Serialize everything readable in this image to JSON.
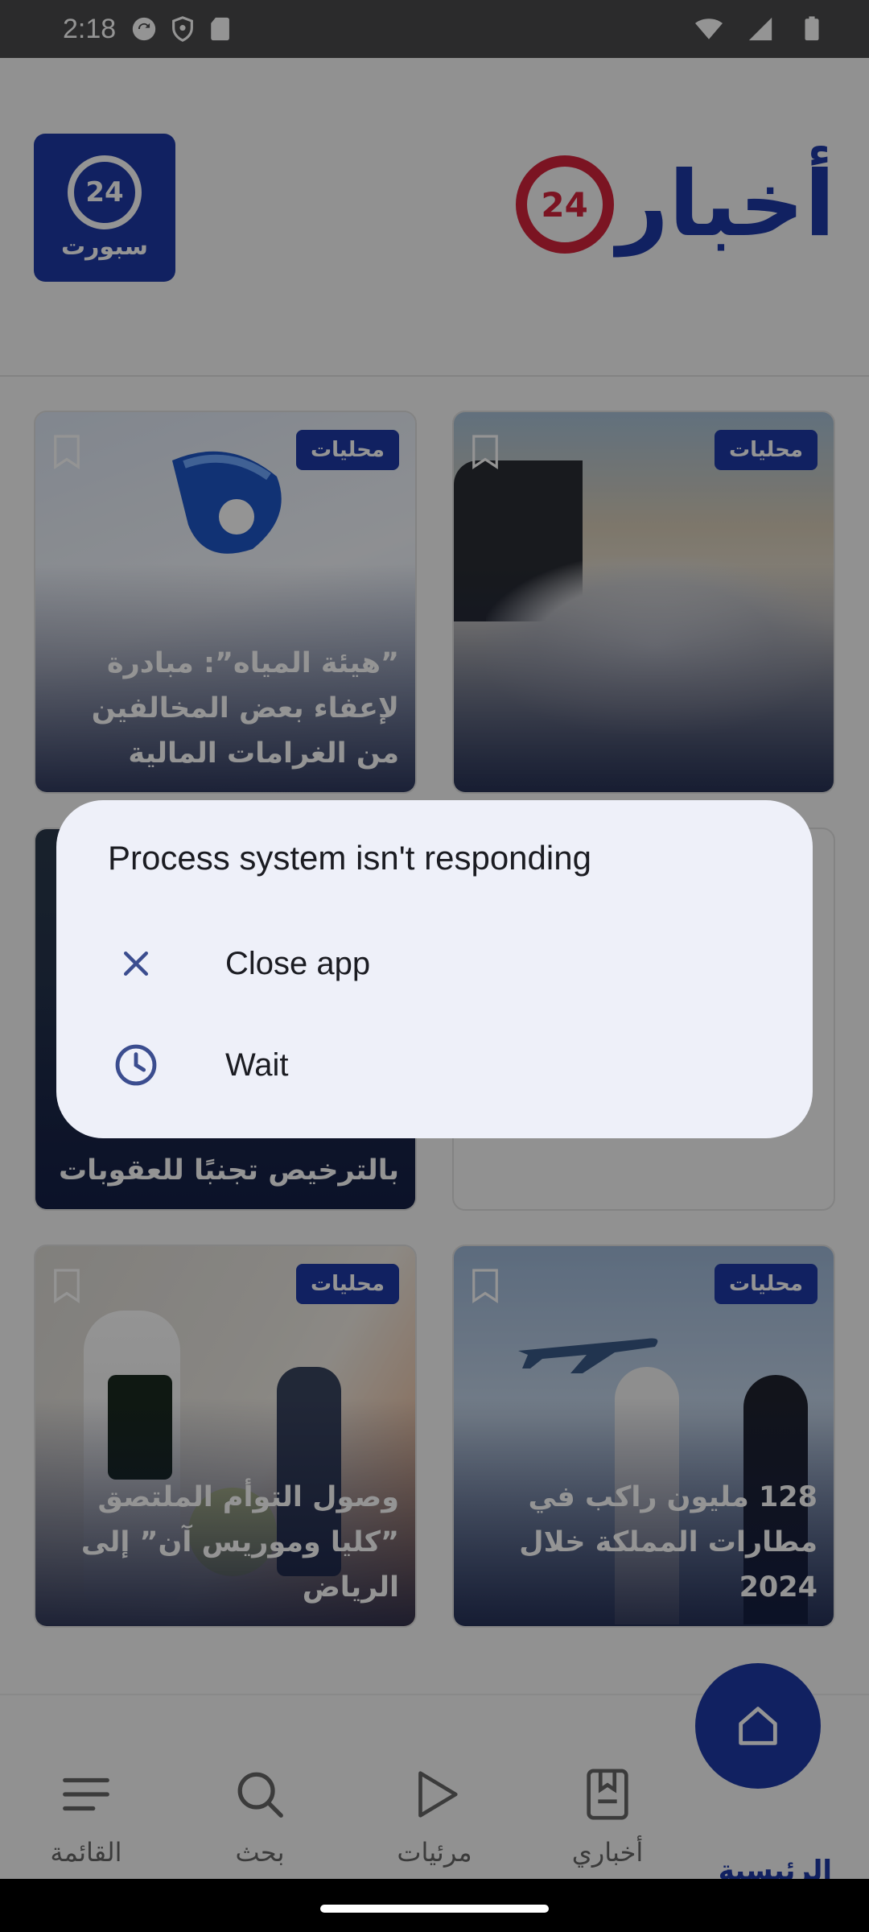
{
  "status_bar": {
    "time": "2:18"
  },
  "header": {
    "sport_logo_number": "24",
    "sport_logo_text": "سبورت",
    "main_logo_word": "أخبار",
    "main_logo_number": "24"
  },
  "cards": [
    {
      "badge": "محليات",
      "title": "”هيئة المياه”: مبادرة لإعفاء بعض المخالفين من الغرامات المالية"
    },
    {
      "badge": "محليات",
      "title": ""
    },
    {
      "badge": "",
      "title": "بالترخيص تجنبًا للعقوبات"
    },
    {
      "badge": "",
      "title": ""
    },
    {
      "badge": "محليات",
      "title": "وصول التوأم الملتصق ”كليا وموريس آن” إلى الرياض"
    },
    {
      "badge": "محليات",
      "title": "128 مليون راكب في مطارات المملكة خلال 2024"
    }
  ],
  "bottom_nav": {
    "menu": "القائمة",
    "search": "بحث",
    "videos": "مرئيات",
    "my_news": "أخباري",
    "home": "الرئيسية"
  },
  "dialog": {
    "title": "Process system isn't responding",
    "close_label": "Close app",
    "wait_label": "Wait"
  },
  "colors": {
    "brand_blue": "#1e3aa8",
    "brand_red": "#d4243b"
  }
}
